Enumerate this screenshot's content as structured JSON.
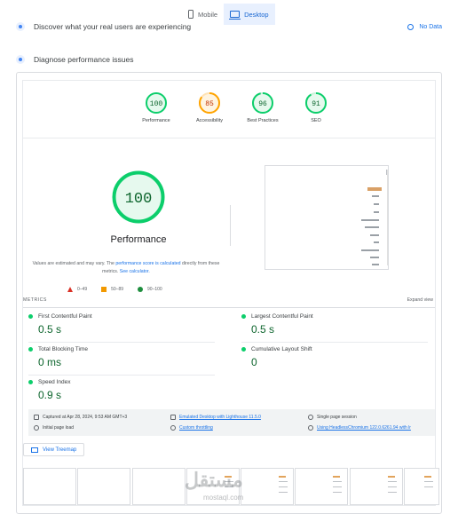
{
  "tabs": {
    "mobile": "Mobile",
    "desktop": "Desktop",
    "active": "desktop"
  },
  "sections": {
    "discover": "Discover what your real users are experiencing",
    "no_data": "No Data",
    "diagnose": "Diagnose performance issues"
  },
  "scores": [
    {
      "label": "Performance",
      "value": "100",
      "color": "#0cce6b"
    },
    {
      "label": "Accessibility",
      "value": "85",
      "color": "#ffa400"
    },
    {
      "label": "Best Practices",
      "value": "96",
      "color": "#0cce6b"
    },
    {
      "label": "SEO",
      "value": "91",
      "color": "#0cce6b"
    }
  ],
  "main_gauge": {
    "value": "100",
    "title": "Performance"
  },
  "perf_note": {
    "text1": "Values are estimated and may vary. The ",
    "link1": "performance score is calculated",
    "text2": " directly from these metrics. ",
    "link2": "See calculator."
  },
  "legend": {
    "fail": "0–49",
    "average": "50–89",
    "pass": "90–100"
  },
  "metrics_header": {
    "title": "METRICS",
    "expand": "Expand view"
  },
  "metrics": [
    {
      "name": "First Contentful Paint",
      "value": "0.5 s"
    },
    {
      "name": "Largest Contentful Paint",
      "value": "0.5 s"
    },
    {
      "name": "Total Blocking Time",
      "value": "0 ms"
    },
    {
      "name": "Cumulative Layout Shift",
      "value": "0"
    },
    {
      "name": "Speed Index",
      "value": "0.9 s"
    }
  ],
  "info": {
    "captured": "Captured at Apr 28, 2024, 9:53 AM GMT+3",
    "initial_load": "Initial page load",
    "emulated": "Emulated Desktop with Lighthouse 11.5.0",
    "throttling": "Custom throttling",
    "session": "Single page session",
    "browser": "Using HeadlessChromium 122.0.6261.94 with lr"
  },
  "treemap_button": "View Treemap",
  "watermark": {
    "brand": "مستقل",
    "domain": "mostaql.com"
  }
}
